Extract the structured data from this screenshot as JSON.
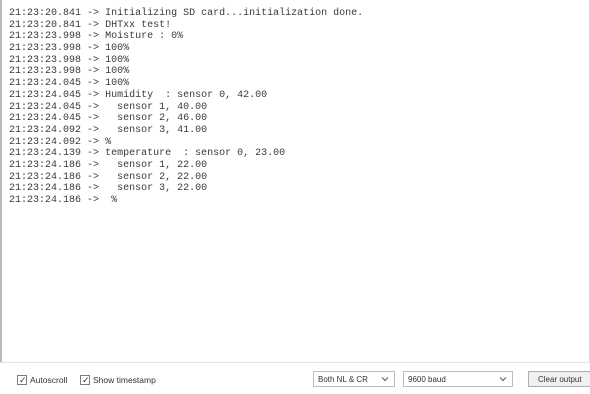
{
  "serial_output": {
    "lines": [
      {
        "timestamp": "21:23:20.841",
        "arrow": "->",
        "message": "Initializing SD card...initialization done."
      },
      {
        "timestamp": "21:23:20.841",
        "arrow": "->",
        "message": "DHTxx test!"
      },
      {
        "timestamp": "21:23:23.998",
        "arrow": "->",
        "message": "Moisture : 0%"
      },
      {
        "timestamp": "21:23:23.998",
        "arrow": "->",
        "message": "100%"
      },
      {
        "timestamp": "21:23:23.998",
        "arrow": "->",
        "message": "100%"
      },
      {
        "timestamp": "21:23:23.998",
        "arrow": "->",
        "message": "100%"
      },
      {
        "timestamp": "21:23:24.045",
        "arrow": "->",
        "message": "100%"
      },
      {
        "timestamp": "21:23:24.045",
        "arrow": "->",
        "message": "Humidity  : sensor 0, 42.00"
      },
      {
        "timestamp": "21:23:24.045",
        "arrow": "->",
        "message": "  sensor 1, 40.00"
      },
      {
        "timestamp": "21:23:24.045",
        "arrow": "->",
        "message": "  sensor 2, 46.00"
      },
      {
        "timestamp": "21:23:24.092",
        "arrow": "->",
        "message": "  sensor 3, 41.00"
      },
      {
        "timestamp": "21:23:24.092",
        "arrow": "->",
        "message": "%"
      },
      {
        "timestamp": "21:23:24.139",
        "arrow": "->",
        "message": "temperature  : sensor 0, 23.00"
      },
      {
        "timestamp": "21:23:24.186",
        "arrow": "->",
        "message": "  sensor 1, 22.00"
      },
      {
        "timestamp": "21:23:24.186",
        "arrow": "->",
        "message": "  sensor 2, 22.00"
      },
      {
        "timestamp": "21:23:24.186",
        "arrow": "->",
        "message": "  sensor 3, 22.00"
      },
      {
        "timestamp": "21:23:24.186",
        "arrow": "->",
        "message": " %"
      }
    ]
  },
  "bottom_bar": {
    "autoscroll": {
      "label": "Autoscroll",
      "checked": true,
      "check_glyph": "✓"
    },
    "show_timestamp": {
      "label": "Show timestamp",
      "checked": true,
      "check_glyph": "✓"
    },
    "line_ending": {
      "value": "Both NL & CR",
      "icon": "chevron-down-icon"
    },
    "baud_rate": {
      "value": "9600 baud",
      "icon": "chevron-down-icon"
    },
    "clear_output": {
      "label": "Clear output"
    }
  }
}
